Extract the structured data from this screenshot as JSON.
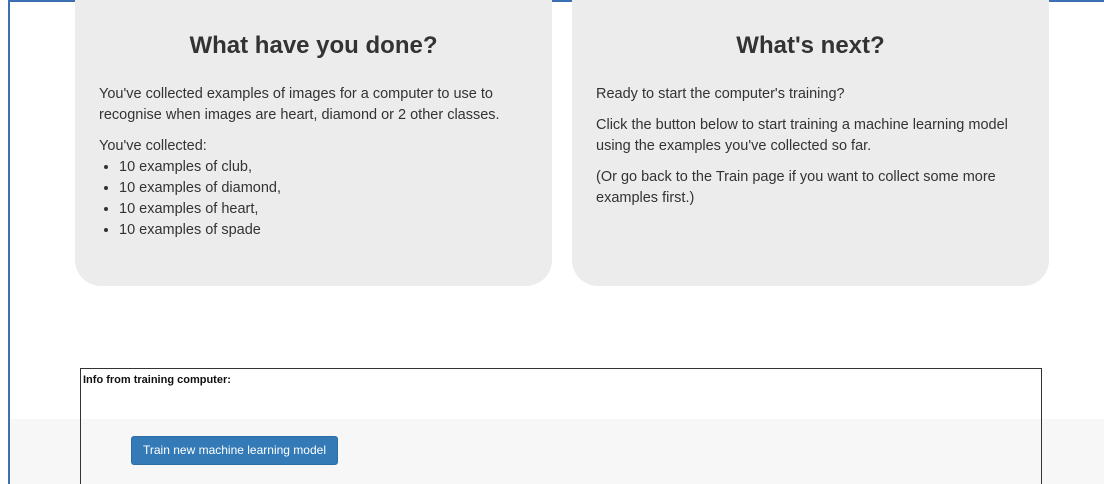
{
  "left_card": {
    "heading": "What have you done?",
    "intro": "You've collected examples of images for a computer to use to recognise when images are heart, diamond or 2 other classes.",
    "collected_label": "You've collected:",
    "items": [
      "10 examples of club,",
      "10 examples of diamond,",
      "10 examples of heart,",
      "10 examples of spade"
    ]
  },
  "right_card": {
    "heading": "What's next?",
    "paragraphs": [
      "Ready to start the computer's training?",
      "Click the button below to start training a machine learning model using the examples you've collected so far.",
      "(Or go back to the Train page if you want to collect some more examples first.)"
    ]
  },
  "info": {
    "label": "Info from training computer:"
  },
  "train_button": {
    "label": "Train new machine learning model"
  },
  "colors": {
    "card_background": "#ececec",
    "button_background": "#337ab7",
    "frame_border": "#3d6fb5"
  }
}
